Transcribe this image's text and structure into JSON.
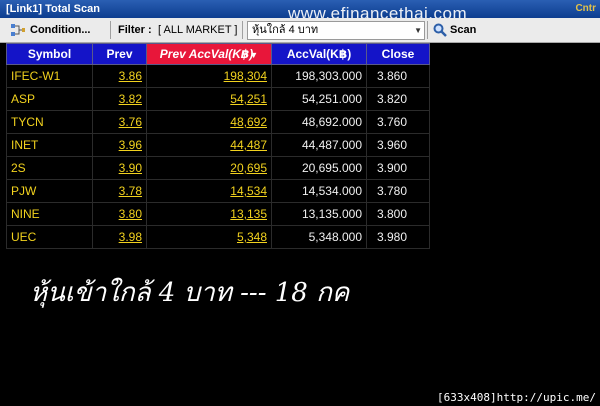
{
  "window": {
    "title": "[Link1] Total Scan",
    "corner_label": "Cntr"
  },
  "watermark": "www.efinancethai.com",
  "toolbar": {
    "condition_label": "Condition...",
    "filter_label": "Filter :",
    "filter_value": "[ ALL MARKET ]",
    "scan_combo_value": "หุ้นใกล้ 4 บาท",
    "scan_label": "Scan"
  },
  "table": {
    "columns": [
      "Symbol",
      "Prev",
      "Prev AccVal(K฿)",
      "AccVal(K฿)",
      "Close"
    ],
    "rows": [
      {
        "symbol": "IFEC-W1",
        "prev": "3.86",
        "prev_accval": "198,304",
        "accval": "198,303.000",
        "close": "3.860"
      },
      {
        "symbol": "ASP",
        "prev": "3.82",
        "prev_accval": "54,251",
        "accval": "54,251.000",
        "close": "3.820"
      },
      {
        "symbol": "TYCN",
        "prev": "3.76",
        "prev_accval": "48,692",
        "accval": "48,692.000",
        "close": "3.760"
      },
      {
        "symbol": "INET",
        "prev": "3.96",
        "prev_accval": "44,487",
        "accval": "44,487.000",
        "close": "3.960"
      },
      {
        "symbol": "2S",
        "prev": "3.90",
        "prev_accval": "20,695",
        "accval": "20,695.000",
        "close": "3.900"
      },
      {
        "symbol": "PJW",
        "prev": "3.78",
        "prev_accval": "14,534",
        "accval": "14,534.000",
        "close": "3.780"
      },
      {
        "symbol": "NINE",
        "prev": "3.80",
        "prev_accval": "13,135",
        "accval": "13,135.000",
        "close": "3.800"
      },
      {
        "symbol": "UEC",
        "prev": "3.98",
        "prev_accval": "5,348",
        "accval": "5,348.000",
        "close": "3.980"
      }
    ]
  },
  "caption": "หุ้นเข้าใกล้ 4 บาท --- 18 กค",
  "footer": "[633x408]http://upic.me/",
  "colors": {
    "header_blue": "#1414c8",
    "sorted_header": "#e8163a",
    "symbol_yellow": "#f2d21e"
  }
}
